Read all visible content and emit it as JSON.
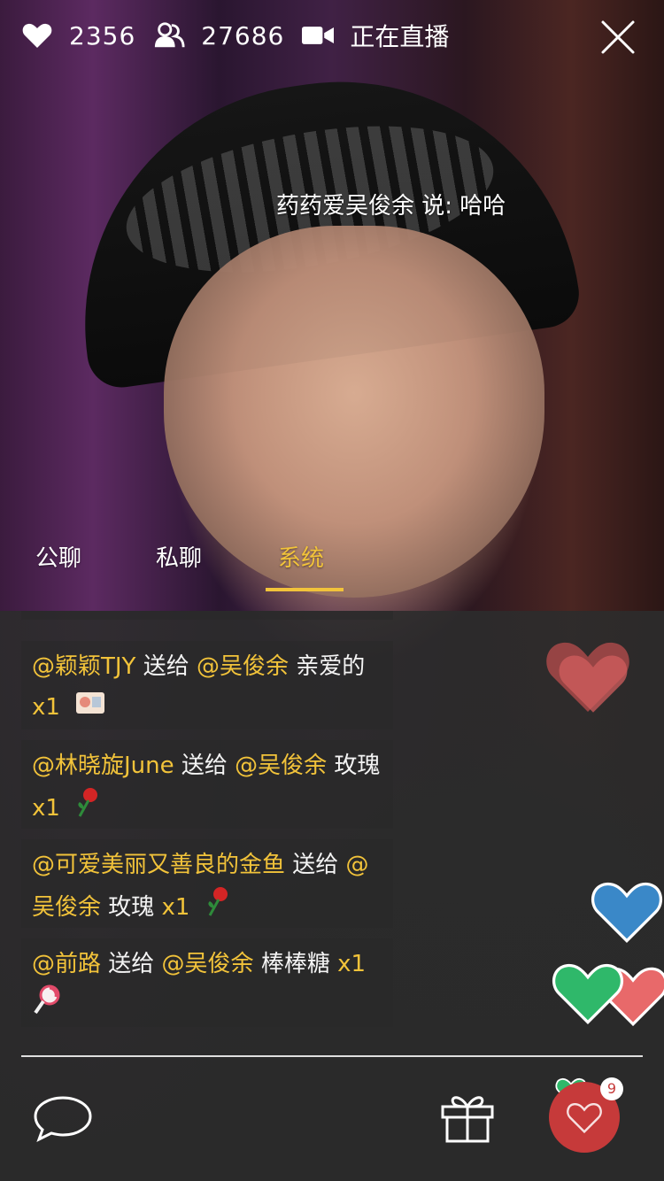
{
  "topbar": {
    "likes": "2356",
    "viewers": "27686",
    "status": "正在直播"
  },
  "barrage": {
    "text": "药药爱吴俊余 说: 哈哈"
  },
  "tabs": [
    "公聊",
    "私聊",
    "系统"
  ],
  "messages": [
    {
      "sender": "@颖颖TJY",
      "verb": " 送给 ",
      "target": "@吴俊余",
      "gift": " 亲爱的",
      "count": "x1"
    },
    {
      "sender": "@林晓旋June",
      "verb": " 送给 ",
      "target": "@吴俊余",
      "gift": " 玫瑰",
      "count": "x1"
    },
    {
      "sender": "@可爱美丽又善良的金鱼",
      "verb": " 送给 ",
      "target_line1": "@",
      "target_line2": "吴俊余",
      "gift": " 玫瑰 ",
      "count": "x1"
    },
    {
      "sender": "@前路",
      "verb": " 送给 ",
      "target": "@吴俊余",
      "gift": " 棒棒糖 ",
      "count": "x1"
    }
  ],
  "like_badge": "9",
  "colors": {
    "accent": "#f2c33a",
    "like_red": "#c63a3a",
    "heart_blue": "#3a88c8",
    "heart_green": "#2fb86a",
    "heart_pink": "#e8696a"
  },
  "icons": [
    "heart-icon",
    "viewers-icon",
    "video-camera-icon",
    "close-icon",
    "chat-bubble-icon",
    "gift-icon",
    "heart-like-icon"
  ]
}
